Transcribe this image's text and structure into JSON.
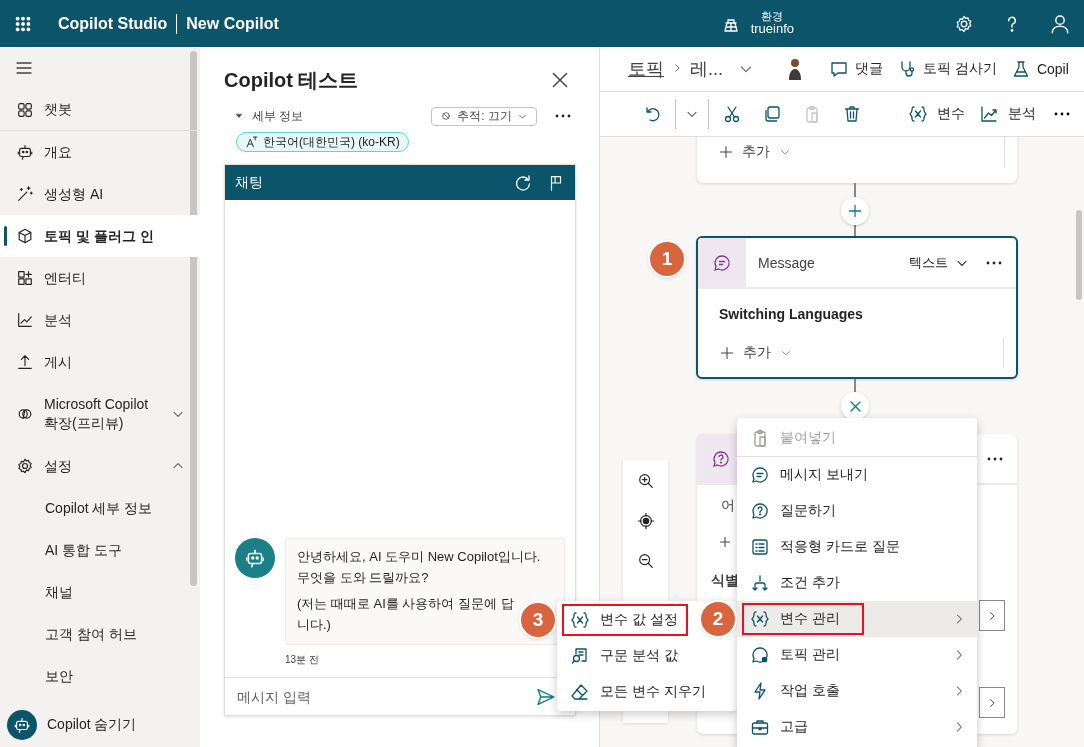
{
  "header": {
    "app_name": "Copilot Studio",
    "project": "New Copilot",
    "environment_label": "환경",
    "environment": "trueinfo"
  },
  "sidebar": {
    "items": [
      {
        "label": "챗봇",
        "selected": false
      },
      {
        "label": "개요",
        "selected": false
      },
      {
        "label": "생성형 AI",
        "selected": false
      },
      {
        "label": "토픽 및 플러그 인",
        "selected": true
      },
      {
        "label": "엔터티",
        "selected": false
      },
      {
        "label": "분석",
        "selected": false
      },
      {
        "label": "게시",
        "selected": false
      },
      {
        "label": "Microsoft Copilot 확장(프리뷰)",
        "selected": false,
        "expanded": false
      },
      {
        "label": "설정",
        "selected": false,
        "expanded": true,
        "children": [
          {
            "label": "Copilot 세부 정보",
            "selected": false
          },
          {
            "label": "AI 통합 도구",
            "selected": false
          },
          {
            "label": "채널",
            "selected": false
          },
          {
            "label": "고객 참여 허브",
            "selected": false
          },
          {
            "label": "보안",
            "selected": false
          }
        ]
      }
    ],
    "footer": "Copilot 숨기기"
  },
  "test_panel": {
    "title": "Copilot 테스트",
    "details": "세부 정보",
    "trace": "추적: 끄기",
    "language": "한국어(대한민국) (ko-KR)",
    "chat": {
      "title": "채팅",
      "message": {
        "paragraphs": [
          [
            "안녕하세요, AI 도우미 New Copilot입니다.",
            "무엇을 도와 드릴까요?"
          ],
          [
            "(저는 때때로 AI를 사용하여 질문에 답",
            "니다.)"
          ]
        ],
        "time": "13분 전"
      },
      "placeholder": "메시지 입력"
    }
  },
  "canvas": {
    "breadcrumb": [
      {
        "label": "토픽"
      },
      {
        "label": "레..."
      }
    ],
    "actions": [
      {
        "label": "댓글"
      },
      {
        "label": "토픽 검사기"
      },
      {
        "label": "Copil"
      }
    ],
    "tools": [
      {
        "disabled": false
      },
      {
        "disabled": false
      },
      {
        "disabled": false
      },
      {
        "disabled": false
      },
      {
        "disabled": true
      },
      {
        "disabled": false
      }
    ],
    "text_tools": [
      {
        "label": "변수"
      },
      {
        "label": "분석"
      }
    ],
    "nodes": [
      {
        "kind": "add",
        "add": "추가"
      },
      {
        "kind": "message",
        "title": "Message",
        "format": "텍스트",
        "text": "Switching Languages",
        "add": "추가",
        "step_badge": "1"
      },
      {
        "kind": "question",
        "text": "어",
        "label": "식별"
      }
    ]
  },
  "menu": {
    "items": [
      {
        "label": "붙여넣기",
        "disabled": true,
        "selected": false,
        "highlighted": false,
        "submenu": false
      },
      {
        "label": "메시지 보내기",
        "disabled": false,
        "selected": false,
        "highlighted": false,
        "submenu": false
      },
      {
        "label": "질문하기",
        "disabled": false,
        "selected": false,
        "highlighted": false,
        "submenu": false
      },
      {
        "label": "적응형 카드로 질문",
        "disabled": false,
        "selected": false,
        "highlighted": false,
        "submenu": false
      },
      {
        "label": "조건 추가",
        "disabled": false,
        "selected": false,
        "highlighted": false,
        "submenu": false
      },
      {
        "label": "변수 관리",
        "disabled": false,
        "selected": true,
        "highlighted": true,
        "submenu": true,
        "step_badge": "2"
      },
      {
        "label": "토픽 관리",
        "disabled": false,
        "selected": false,
        "highlighted": false,
        "submenu": true
      },
      {
        "label": "작업 호출",
        "disabled": false,
        "selected": false,
        "highlighted": false,
        "submenu": true
      },
      {
        "label": "고급",
        "disabled": false,
        "selected": false,
        "highlighted": false,
        "submenu": true
      }
    ]
  },
  "submenu": {
    "items": [
      {
        "label": "변수 값 설정",
        "selected": false,
        "highlighted": true,
        "step_badge": "3"
      },
      {
        "label": "구문 분석 값",
        "selected": false,
        "highlighted": false
      },
      {
        "label": "모든 변수 지우기",
        "selected": false,
        "highlighted": false
      }
    ]
  }
}
